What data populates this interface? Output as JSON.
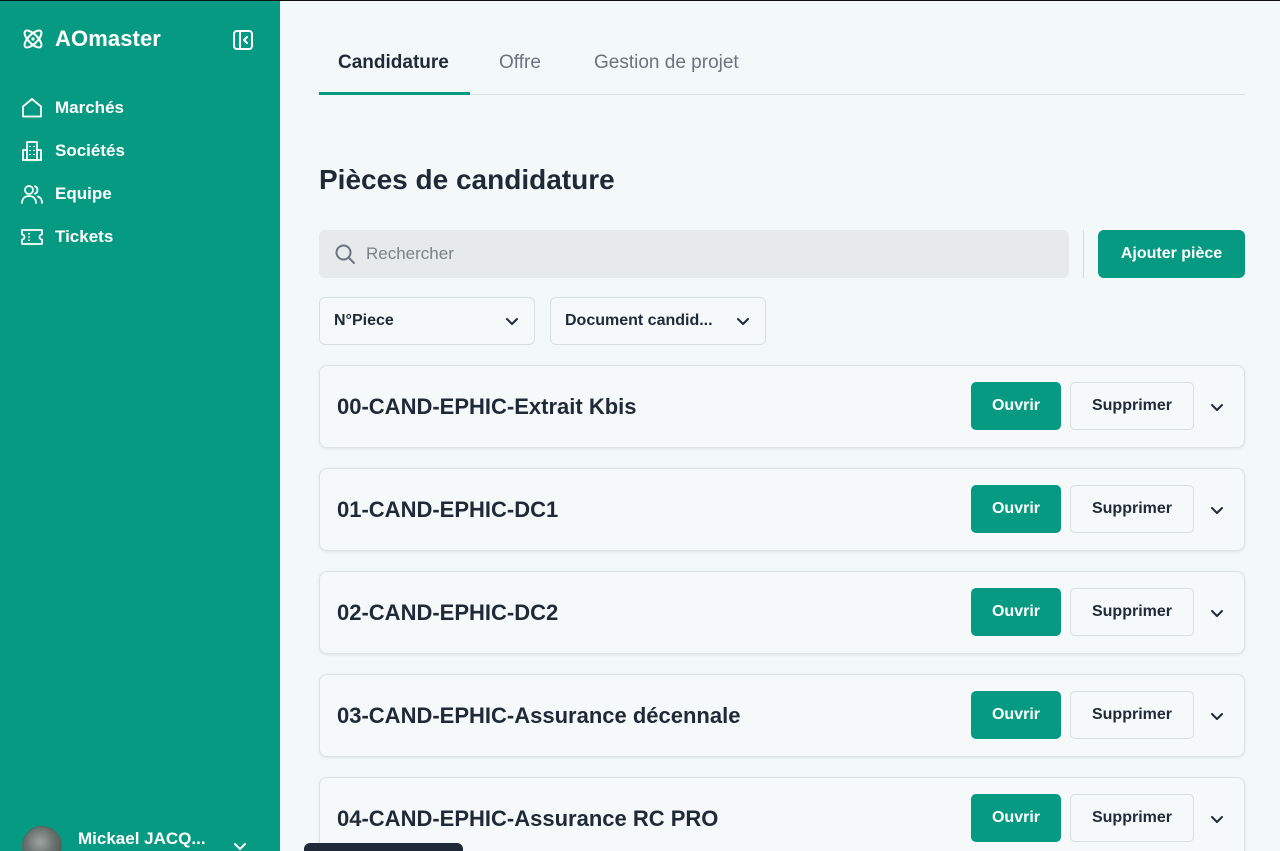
{
  "app": {
    "name": "AOmaster"
  },
  "sidebar": {
    "items": [
      {
        "label": "Marchés",
        "icon": "home-icon"
      },
      {
        "label": "Sociétés",
        "icon": "building-icon"
      },
      {
        "label": "Equipe",
        "icon": "users-icon"
      },
      {
        "label": "Tickets",
        "icon": "ticket-icon"
      }
    ],
    "user": {
      "name": "Mickael JACQ..."
    }
  },
  "tabs": [
    {
      "label": "Candidature",
      "active": true
    },
    {
      "label": "Offre",
      "active": false
    },
    {
      "label": "Gestion de projet",
      "active": false
    }
  ],
  "page": {
    "title": "Pièces de candidature",
    "search_placeholder": "Rechercher",
    "add_button": "Ajouter pièce",
    "filters": [
      {
        "value": "N°Piece"
      },
      {
        "value": "Document candid..."
      }
    ]
  },
  "pieces": [
    {
      "title": "00-CAND-EPHIC-Extrait Kbis",
      "open_label": "Ouvrir",
      "delete_label": "Supprimer"
    },
    {
      "title": "01-CAND-EPHIC-DC1",
      "open_label": "Ouvrir",
      "delete_label": "Supprimer"
    },
    {
      "title": "02-CAND-EPHIC-DC2",
      "open_label": "Ouvrir",
      "delete_label": "Supprimer"
    },
    {
      "title": "03-CAND-EPHIC-Assurance décennale",
      "open_label": "Ouvrir",
      "delete_label": "Supprimer"
    },
    {
      "title": "04-CAND-EPHIC-Assurance RC PRO",
      "open_label": "Ouvrir",
      "delete_label": "Supprimer"
    }
  ],
  "colors": {
    "primary": "#069a82",
    "background": "#f3f8f8",
    "text": "#1f2937"
  }
}
